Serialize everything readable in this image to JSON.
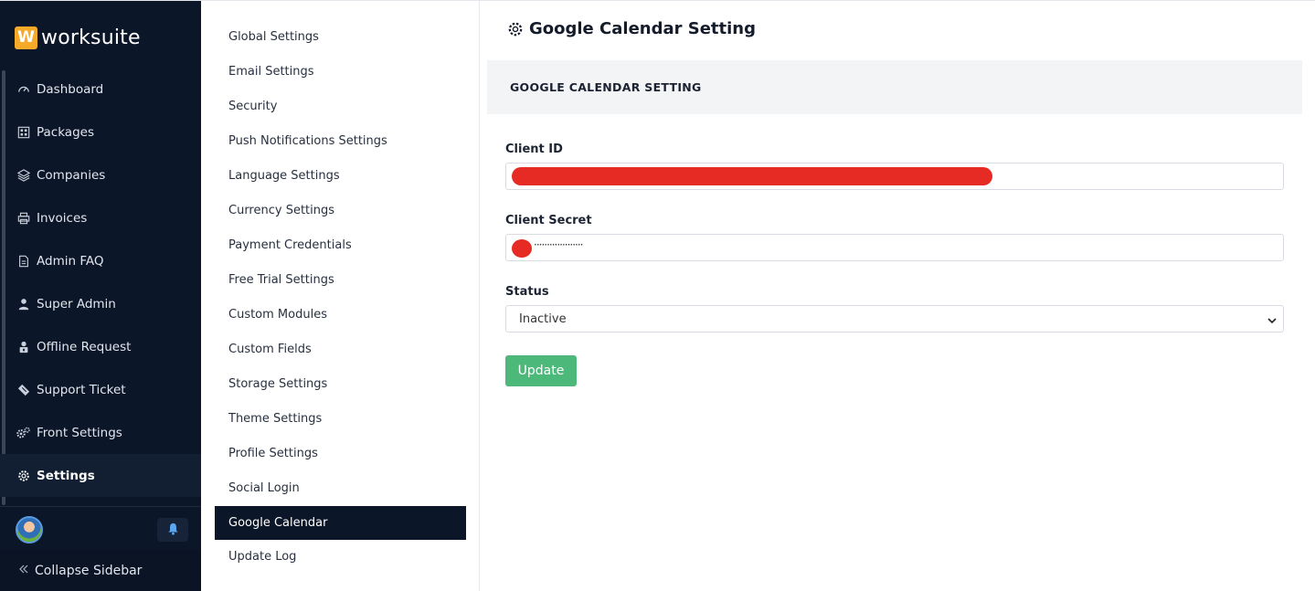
{
  "brand": {
    "mark": "W",
    "name": "worksuite"
  },
  "sidebar": {
    "items": [
      {
        "label": "Dashboard",
        "icon": "speedometer-icon"
      },
      {
        "label": "Packages",
        "icon": "packages-grid-icon"
      },
      {
        "label": "Companies",
        "icon": "layers-icon"
      },
      {
        "label": "Invoices",
        "icon": "printer-icon"
      },
      {
        "label": "Admin FAQ",
        "icon": "document-icon"
      },
      {
        "label": "Super Admin",
        "icon": "user-icon"
      },
      {
        "label": "Offline Request",
        "icon": "user-lock-icon"
      },
      {
        "label": "Support Ticket",
        "icon": "ticket-icon"
      },
      {
        "label": "Front Settings",
        "icon": "gears-icon"
      },
      {
        "label": "Settings",
        "icon": "gear-icon",
        "active": true
      }
    ],
    "collapse_label": "Collapse Sidebar"
  },
  "settings_menu": {
    "items": [
      "Global Settings",
      "Email Settings",
      "Security",
      "Push Notifications Settings",
      "Language Settings",
      "Currency Settings",
      "Payment Credentials",
      "Free Trial Settings",
      "Custom Modules",
      "Custom Fields",
      "Storage Settings",
      "Theme Settings",
      "Profile Settings",
      "Social Login",
      "Google Calendar",
      "Update Log"
    ],
    "active": "Google Calendar"
  },
  "main": {
    "title": "Google Calendar Setting",
    "card_header": "GOOGLE CALENDAR SETTING",
    "client_id": {
      "label": "Client ID"
    },
    "client_secret": {
      "label": "Client Secret",
      "masked": "···················"
    },
    "status": {
      "label": "Status",
      "value": "Inactive"
    },
    "update_label": "Update"
  },
  "colors": {
    "sidebar_bg": "#0b1628",
    "accent_green": "#4cb97b",
    "redaction": "#e52b24"
  }
}
